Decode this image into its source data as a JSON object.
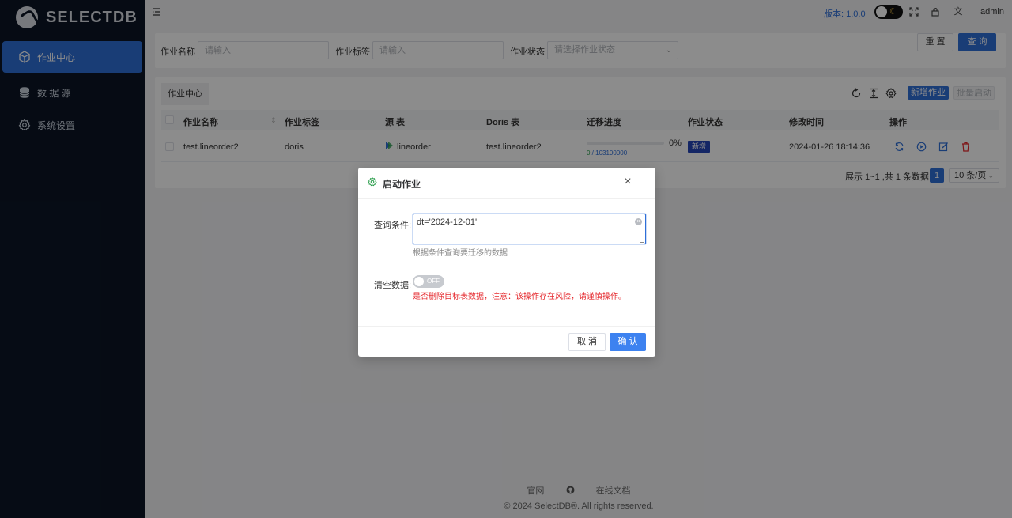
{
  "app": {
    "logo_text": "SELECTDB"
  },
  "sidebar": {
    "items": [
      {
        "label": "作业中心",
        "icon": "cube-icon",
        "active": true
      },
      {
        "label": "数 据 源",
        "icon": "database-icon",
        "active": false
      },
      {
        "label": "系统设置",
        "icon": "gear-icon",
        "active": false
      }
    ]
  },
  "header": {
    "version": "版本: 1.0.0",
    "user": "admin"
  },
  "search": {
    "name_label": "作业名称",
    "name_placeholder": "请输入",
    "tag_label": "作业标签",
    "tag_placeholder": "请输入",
    "status_label": "作业状态",
    "status_placeholder": "请选择作业状态",
    "reset_label": "重 置",
    "query_label": "查 询"
  },
  "table": {
    "tab_label": "作业中心",
    "add_label": "新增作业",
    "batch_label": "批量启动",
    "columns": [
      "作业名称",
      "作业标签",
      "源 表",
      "Doris 表",
      "迁移进度",
      "作业状态",
      "修改时间",
      "操作"
    ],
    "rows": [
      {
        "name": "test.lineorder2",
        "tag": "doris",
        "source": "lineorder",
        "doris": "test.lineorder2",
        "progress_percent": 0,
        "progress_pct_text": "0%",
        "progress_done": "0",
        "progress_total": " / 103100000",
        "status": "新增",
        "modified": "2024-01-26 18:14:36"
      }
    ],
    "pager_text": "展示 1~1 ,共 1 条数据",
    "page_current": "1",
    "page_size": "10 条/页"
  },
  "footer": {
    "site_link": "官网",
    "docs_link": "在线文档",
    "copyright": "© 2024 SelectDB®. All rights reserved."
  },
  "modal": {
    "title": "启动作业",
    "condition_label": "查询条件:",
    "condition_value": "dt='2024-12-01'",
    "condition_hint": "根据条件查询要迁移的数据",
    "clear_label": "清空数据:",
    "switch_text": "OFF",
    "warning": "是否删除目标表数据，注意：该操作存在风险，请谨慎操作。",
    "cancel_label": "取 消",
    "confirm_label": "确 认"
  },
  "colors": {
    "primary": "#2f6fd8",
    "sidebar_bg": "#0b1526",
    "danger": "#e5262b",
    "success": "#2a9d4b"
  }
}
